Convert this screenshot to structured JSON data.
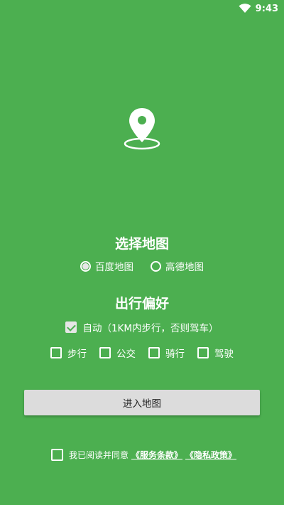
{
  "status_bar": {
    "time": "9:43",
    "wifi_icon": "wifi-icon"
  },
  "map_select": {
    "title": "选择地图",
    "options": [
      {
        "label": "百度地图",
        "selected": true
      },
      {
        "label": "高德地图",
        "selected": false
      }
    ]
  },
  "travel_pref": {
    "title": "出行偏好",
    "auto": {
      "label": "自动（1KM内步行，否则驾车）",
      "checked": true
    },
    "modes": [
      {
        "label": "步行",
        "checked": false
      },
      {
        "label": "公交",
        "checked": false
      },
      {
        "label": "骑行",
        "checked": false
      },
      {
        "label": "驾驶",
        "checked": false
      }
    ]
  },
  "enter_button": {
    "label": "进入地图"
  },
  "agreement": {
    "text": "我已阅读并同意",
    "service_terms": "《服务条款》",
    "privacy_policy": "《隐私政策》",
    "checked": false
  },
  "colors": {
    "background": "#4caf50",
    "button": "#dcdcdc"
  }
}
